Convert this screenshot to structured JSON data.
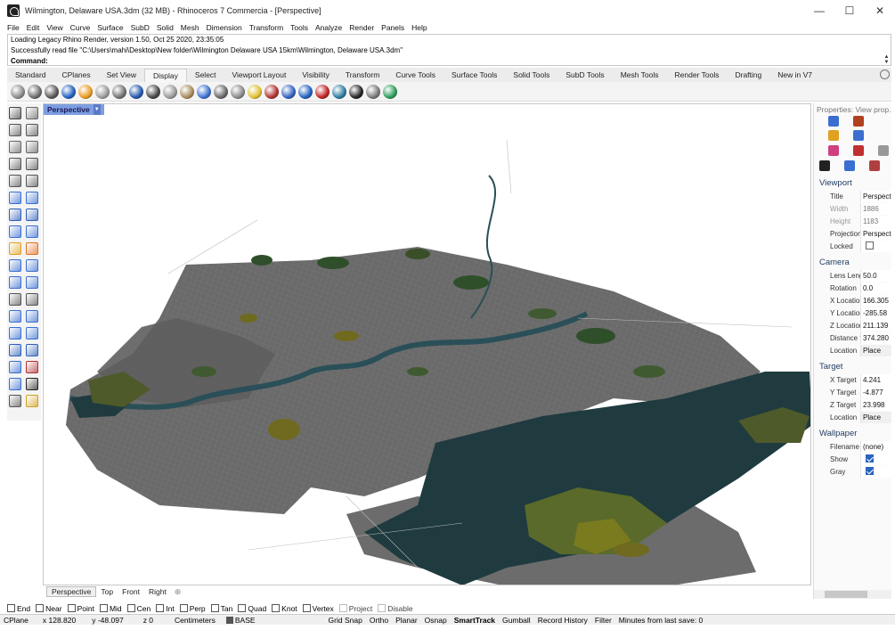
{
  "window": {
    "title": "Wilmington, Delaware USA.3dm (32 MB) - Rhinoceros 7 Commercia - [Perspective]",
    "minimize": "—",
    "maximize": "☐",
    "close": "✕"
  },
  "menu": [
    "File",
    "Edit",
    "View",
    "Curve",
    "Surface",
    "SubD",
    "Solid",
    "Mesh",
    "Dimension",
    "Transform",
    "Tools",
    "Analyze",
    "Render",
    "Panels",
    "Help"
  ],
  "command": {
    "lines": [
      "Loading Legacy Rhino Render, version 1.50, Oct 25 2020, 23:35:05",
      "Successfully read file \"C:\\Users\\mahi\\Desktop\\New folder\\Wilmington Delaware USA 15km\\Wilmington, Delaware USA.3dm\""
    ],
    "prompt": "Command:",
    "scroll_up": "▲",
    "scroll_down": "▼"
  },
  "toolbar_tabs": [
    "Standard",
    "CPlanes",
    "Set View",
    "Display",
    "Select",
    "Viewport Layout",
    "Visibility",
    "Transform",
    "Curve Tools",
    "Surface Tools",
    "Solid Tools",
    "SubD Tools",
    "Mesh Tools",
    "Render Tools",
    "Drafting",
    "New in V7"
  ],
  "active_tab": "Display",
  "toolbar_icons": [
    {
      "name": "wireframe-icon",
      "color": "#8a8a8a"
    },
    {
      "name": "shaded-icon",
      "color": "#6a6a6a"
    },
    {
      "name": "rendered-icon",
      "color": "#555555"
    },
    {
      "name": "ghosted-icon",
      "color": "#1f5fbf"
    },
    {
      "name": "xray-icon",
      "color": "#e89a1e"
    },
    {
      "name": "technical-icon",
      "color": "#9a9a9a"
    },
    {
      "name": "artistic-icon",
      "color": "#707070"
    },
    {
      "name": "pen-icon",
      "color": "#2255aa"
    },
    {
      "name": "monochrome-icon",
      "color": "#444444"
    },
    {
      "name": "raytraced-icon",
      "color": "#999999"
    },
    {
      "name": "arctic-icon",
      "color": "#a88a5a"
    },
    {
      "name": "display-options-icon",
      "color": "#3a6fd0"
    },
    {
      "name": "zebra-icon",
      "color": "#666666"
    },
    {
      "name": "env-map-icon",
      "color": "#888888"
    },
    {
      "name": "light-icon",
      "color": "#e0c030"
    },
    {
      "name": "clipping-icon",
      "color": "#b03030"
    },
    {
      "name": "section-icon",
      "color": "#3060c0"
    },
    {
      "name": "shadow-icon",
      "color": "#1f5fbf"
    },
    {
      "name": "hide-icon",
      "color": "#c02020"
    },
    {
      "name": "show-icon",
      "color": "#2a7aa0"
    },
    {
      "name": "capture-icon",
      "color": "#222222"
    },
    {
      "name": "box-icon",
      "color": "#777777"
    },
    {
      "name": "layers-icon",
      "color": "#2a9a5a"
    }
  ],
  "left_tools": [
    {
      "name": "select-arrow-icon",
      "color": "#444444"
    },
    {
      "name": "point-icon",
      "color": "#666666"
    },
    {
      "name": "polyline-icon",
      "color": "#555555"
    },
    {
      "name": "curve-cp-icon",
      "color": "#555555"
    },
    {
      "name": "circle-icon",
      "color": "#666666"
    },
    {
      "name": "circle-3pt-icon",
      "color": "#666666"
    },
    {
      "name": "arc-icon",
      "color": "#555555"
    },
    {
      "name": "rectangle-icon",
      "color": "#555555"
    },
    {
      "name": "ellipse-icon",
      "color": "#555555"
    },
    {
      "name": "fillet-curve-icon",
      "color": "#555555"
    },
    {
      "name": "plane-surface-icon",
      "color": "#3a6fd0"
    },
    {
      "name": "extrude-icon",
      "color": "#3a6fd0"
    },
    {
      "name": "box-solid-icon",
      "color": "#2f5fb8"
    },
    {
      "name": "sphere-solid-icon",
      "color": "#2f5fb8"
    },
    {
      "name": "cylinder-icon",
      "color": "#3a6fd0"
    },
    {
      "name": "mesh-plane-icon",
      "color": "#3a6fd0"
    },
    {
      "name": "explode-icon",
      "color": "#e0a020"
    },
    {
      "name": "join-icon",
      "color": "#e07020"
    },
    {
      "name": "trim-icon",
      "color": "#3a6fd0"
    },
    {
      "name": "split-icon",
      "color": "#3a6fd0"
    },
    {
      "name": "group-icon",
      "color": "#3a6fd0"
    },
    {
      "name": "ungroup-icon",
      "color": "#3a6fd0"
    },
    {
      "name": "offset-curve-icon",
      "color": "#555555"
    },
    {
      "name": "offset-srf-icon",
      "color": "#555555"
    },
    {
      "name": "text-icon",
      "color": "#3a6fd0"
    },
    {
      "name": "dimension-icon",
      "color": "#3a6fd0"
    },
    {
      "name": "move-icon",
      "color": "#3a6fd0"
    },
    {
      "name": "copy-icon",
      "color": "#3a6fd0"
    },
    {
      "name": "boolean-icon",
      "color": "#2f5fb8"
    },
    {
      "name": "measure-icon",
      "color": "#2f5fb8"
    },
    {
      "name": "array-icon",
      "color": "#3a6fd0"
    },
    {
      "name": "history-icon",
      "color": "#b03030"
    },
    {
      "name": "layer-panel-icon",
      "color": "#3a6fd0"
    },
    {
      "name": "check-icon",
      "color": "#222222"
    },
    {
      "name": "analyze-icon",
      "color": "#555555"
    },
    {
      "name": "render-preview-icon",
      "color": "#d0a020"
    }
  ],
  "viewport": {
    "label": "Perspective",
    "arrow": "▼",
    "tabs": [
      "Perspective",
      "Top",
      "Front",
      "Right"
    ],
    "active_tab": "Perspective",
    "add_tab": "⊕",
    "colors": {
      "land": "#6f6f6f",
      "land_dark": "#5a5a5a",
      "water": "#1f3b3f",
      "vegetation": "#4f5a2a",
      "green": "#2f4f2a",
      "yellow": "#6f6a1f"
    }
  },
  "properties": {
    "title": "Properties: View prop...",
    "icons_row1": [
      {
        "name": "material-icon",
        "color": "#3a6fd0"
      },
      {
        "name": "pencil-icon",
        "color": "#b04020"
      }
    ],
    "icons_row2": [
      {
        "name": "folder-icon",
        "color": "#e0a020"
      },
      {
        "name": "document-icon",
        "color": "#3a6fd0"
      }
    ],
    "icons_row3": [
      {
        "name": "color-wheel-icon",
        "color": "#d04080"
      },
      {
        "name": "paint-bucket-icon",
        "color": "#c03030"
      },
      {
        "name": "expand-icon",
        "color": "#999999"
      }
    ],
    "icons_row4": [
      {
        "name": "camera-icon",
        "color": "#222222"
      },
      {
        "name": "light-cluster-icon",
        "color": "#3a6fd0"
      },
      {
        "name": "frame-icon",
        "color": "#b04040"
      }
    ],
    "sections": [
      {
        "title": "Viewport",
        "rows": [
          {
            "key": "Title",
            "value": "Perspective"
          },
          {
            "key": "Width",
            "value": "1886",
            "dim": true
          },
          {
            "key": "Height",
            "value": "1183",
            "dim": true
          },
          {
            "key": "Projection",
            "value": "Perspective"
          },
          {
            "key": "Locked",
            "checkbox": false
          }
        ]
      },
      {
        "title": "Camera",
        "rows": [
          {
            "key": "Lens Length",
            "value": "50.0"
          },
          {
            "key": "Rotation",
            "value": "0.0"
          },
          {
            "key": "X Location",
            "value": "166.305"
          },
          {
            "key": "Y Location",
            "value": "-285.58"
          },
          {
            "key": "Z Location",
            "value": "211.139"
          },
          {
            "key": "Distance to Target",
            "value": "374.280"
          },
          {
            "key": "Location",
            "value": "Place",
            "button": true
          }
        ]
      },
      {
        "title": "Target",
        "rows": [
          {
            "key": "X Target",
            "value": "4.241"
          },
          {
            "key": "Y Target",
            "value": "-4.877"
          },
          {
            "key": "Z Target",
            "value": "23.998"
          },
          {
            "key": "Location",
            "value": "Place",
            "button": true
          }
        ]
      },
      {
        "title": "Wallpaper",
        "rows": [
          {
            "key": "Filename",
            "value": "(none)"
          },
          {
            "key": "Show",
            "checkbox": true
          },
          {
            "key": "Gray",
            "checkbox": true
          }
        ]
      }
    ]
  },
  "osnaps": [
    {
      "label": "End",
      "checked": false
    },
    {
      "label": "Near",
      "checked": false
    },
    {
      "label": "Point",
      "checked": false
    },
    {
      "label": "Mid",
      "checked": false
    },
    {
      "label": "Cen",
      "checked": false
    },
    {
      "label": "Int",
      "checked": false
    },
    {
      "label": "Perp",
      "checked": false
    },
    {
      "label": "Tan",
      "checked": false
    },
    {
      "label": "Quad",
      "checked": false
    },
    {
      "label": "Knot",
      "checked": false
    },
    {
      "label": "Vertex",
      "checked": false
    },
    {
      "label": "Project",
      "checked": false,
      "dim": true
    },
    {
      "label": "Disable",
      "checked": false,
      "dim": true
    }
  ],
  "status": {
    "cplane": "CPlane",
    "x": "x 128.820",
    "y": "y -48.097",
    "z": "z 0",
    "units": "Centimeters",
    "layer": "BASE",
    "grid_snap": "Grid Snap",
    "ortho": "Ortho",
    "planar": "Planar",
    "osnap": "Osnap",
    "smarttrack": "SmartTrack",
    "gumball": "Gumball",
    "record_history": "Record History",
    "filter": "Filter",
    "save_msg": "Minutes from last save: 0"
  }
}
